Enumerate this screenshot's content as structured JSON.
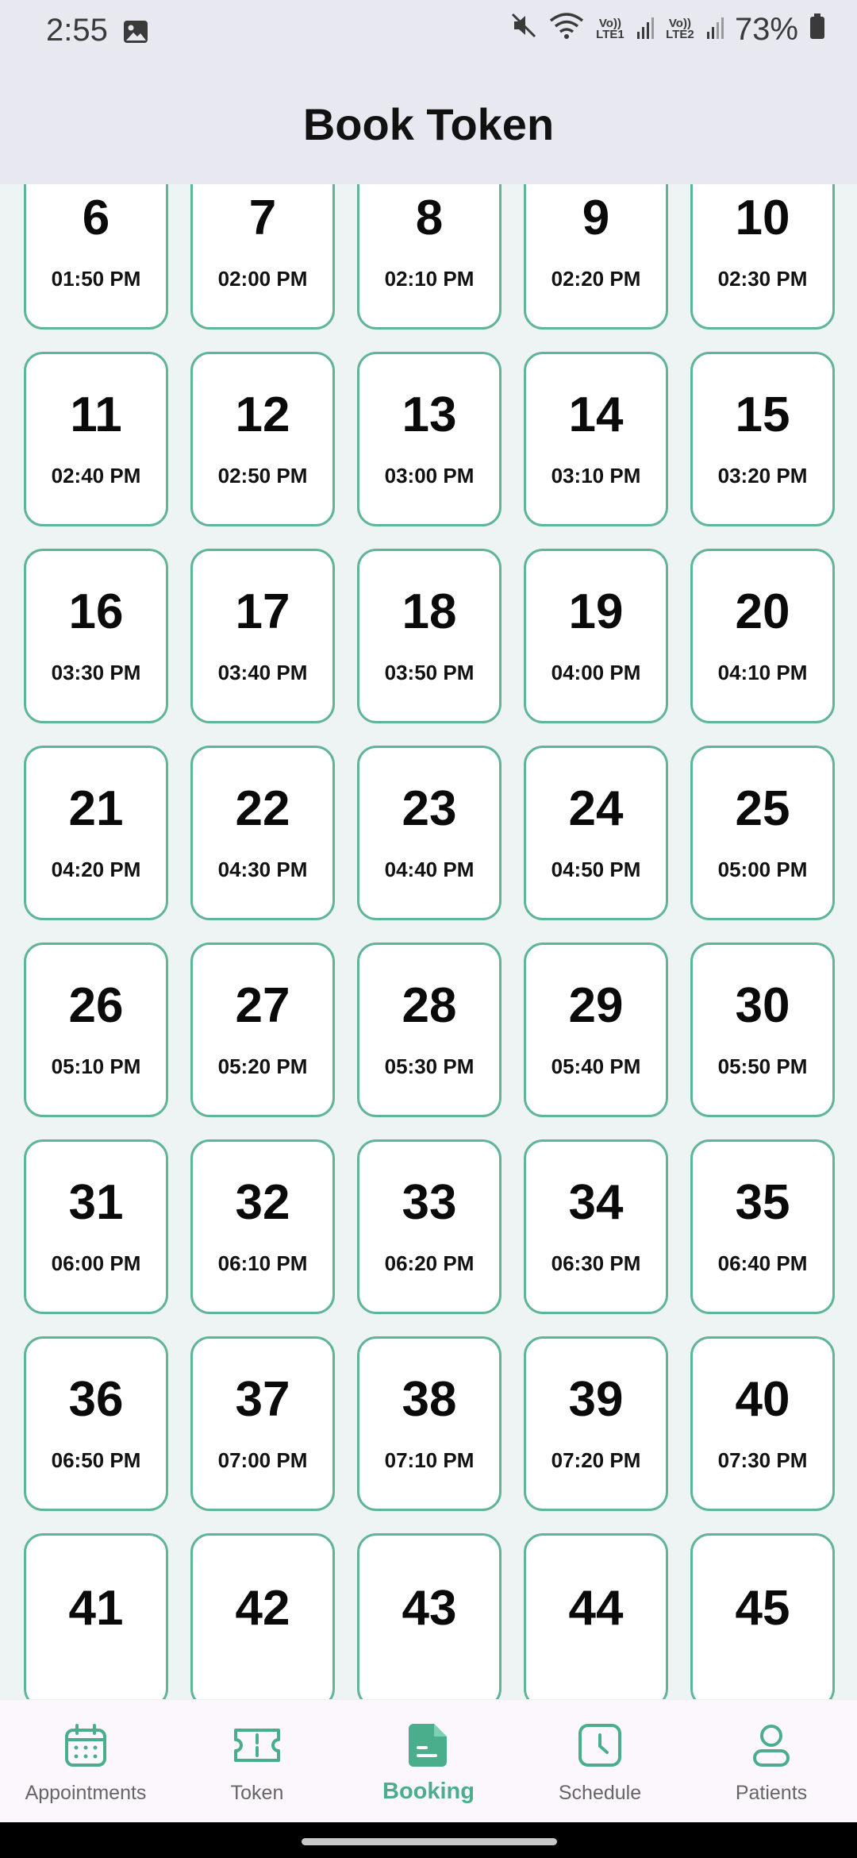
{
  "status_bar": {
    "time": "2:55",
    "sim1": "Vo)) LTE1",
    "sim2": "Vo)) LTE2",
    "battery": "73%"
  },
  "header": {
    "title": "Book Token"
  },
  "tokens": [
    {
      "num": "",
      "time": ""
    },
    {
      "num": "",
      "time": ""
    },
    {
      "num": "",
      "time": ""
    },
    {
      "num": "",
      "time": ""
    },
    {
      "num": "",
      "time": ""
    },
    {
      "num": "6",
      "time": "01:50 PM"
    },
    {
      "num": "7",
      "time": "02:00 PM"
    },
    {
      "num": "8",
      "time": "02:10 PM"
    },
    {
      "num": "9",
      "time": "02:20 PM"
    },
    {
      "num": "10",
      "time": "02:30 PM"
    },
    {
      "num": "11",
      "time": "02:40 PM"
    },
    {
      "num": "12",
      "time": "02:50 PM"
    },
    {
      "num": "13",
      "time": "03:00 PM"
    },
    {
      "num": "14",
      "time": "03:10 PM"
    },
    {
      "num": "15",
      "time": "03:20 PM"
    },
    {
      "num": "16",
      "time": "03:30 PM"
    },
    {
      "num": "17",
      "time": "03:40 PM"
    },
    {
      "num": "18",
      "time": "03:50 PM"
    },
    {
      "num": "19",
      "time": "04:00 PM"
    },
    {
      "num": "20",
      "time": "04:10 PM"
    },
    {
      "num": "21",
      "time": "04:20 PM"
    },
    {
      "num": "22",
      "time": "04:30 PM"
    },
    {
      "num": "23",
      "time": "04:40 PM"
    },
    {
      "num": "24",
      "time": "04:50 PM"
    },
    {
      "num": "25",
      "time": "05:00 PM"
    },
    {
      "num": "26",
      "time": "05:10 PM"
    },
    {
      "num": "27",
      "time": "05:20 PM"
    },
    {
      "num": "28",
      "time": "05:30 PM"
    },
    {
      "num": "29",
      "time": "05:40 PM"
    },
    {
      "num": "30",
      "time": "05:50 PM"
    },
    {
      "num": "31",
      "time": "06:00 PM"
    },
    {
      "num": "32",
      "time": "06:10 PM"
    },
    {
      "num": "33",
      "time": "06:20 PM"
    },
    {
      "num": "34",
      "time": "06:30 PM"
    },
    {
      "num": "35",
      "time": "06:40 PM"
    },
    {
      "num": "36",
      "time": "06:50 PM"
    },
    {
      "num": "37",
      "time": "07:00 PM"
    },
    {
      "num": "38",
      "time": "07:10 PM"
    },
    {
      "num": "39",
      "time": "07:20 PM"
    },
    {
      "num": "40",
      "time": "07:30 PM"
    },
    {
      "num": "41",
      "time": ""
    },
    {
      "num": "42",
      "time": ""
    },
    {
      "num": "43",
      "time": ""
    },
    {
      "num": "44",
      "time": ""
    },
    {
      "num": "45",
      "time": ""
    }
  ],
  "bottom_nav": [
    {
      "label": "Appointments",
      "icon": "calendar-icon",
      "active": false
    },
    {
      "label": "Token",
      "icon": "ticket-icon",
      "active": false
    },
    {
      "label": "Booking",
      "icon": "document-icon",
      "active": true
    },
    {
      "label": "Schedule",
      "icon": "clock-icon",
      "active": false
    },
    {
      "label": "Patients",
      "icon": "person-icon",
      "active": false
    }
  ],
  "colors": {
    "accent": "#4aae8c",
    "tile_border": "#5fb595",
    "header_bg": "#e8e9f0",
    "page_bg": "#eef3f4"
  }
}
